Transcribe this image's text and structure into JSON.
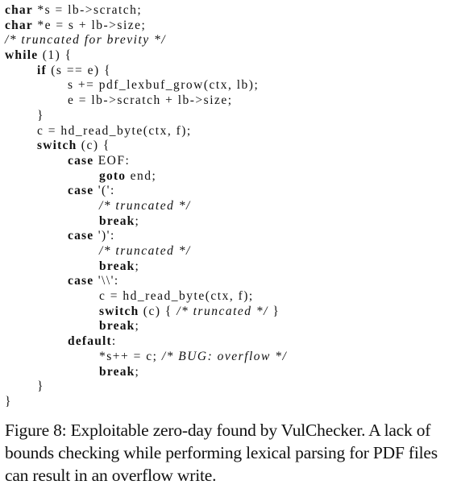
{
  "code": {
    "lines": [
      {
        "indent": 0,
        "tokens": [
          {
            "t": "char",
            "k": "kw"
          },
          {
            "t": " *s = lb->scratch;"
          }
        ]
      },
      {
        "indent": 0,
        "tokens": [
          {
            "t": "char",
            "k": "kw"
          },
          {
            "t": " *e = s + lb->size;"
          }
        ]
      },
      {
        "indent": 0,
        "tokens": [
          {
            "t": "/* truncated for brevity */",
            "k": "cm"
          }
        ]
      },
      {
        "indent": 0,
        "tokens": [
          {
            "t": "while",
            "k": "kw"
          },
          {
            "t": " (1) {"
          }
        ]
      },
      {
        "indent": 1,
        "tokens": [
          {
            "t": "if",
            "k": "kw"
          },
          {
            "t": " (s == e) {"
          }
        ]
      },
      {
        "indent": 2,
        "tokens": [
          {
            "t": "s += pdf_lexbuf_grow(ctx, lb);"
          }
        ]
      },
      {
        "indent": 2,
        "tokens": [
          {
            "t": "e = lb->scratch + lb->size;"
          }
        ]
      },
      {
        "indent": 1,
        "tokens": [
          {
            "t": "}"
          }
        ]
      },
      {
        "indent": 1,
        "tokens": [
          {
            "t": "c = hd_read_byte(ctx, f);"
          }
        ]
      },
      {
        "indent": 1,
        "tokens": [
          {
            "t": "switch",
            "k": "kw"
          },
          {
            "t": " (c) {"
          }
        ]
      },
      {
        "indent": 2,
        "tokens": [
          {
            "t": "case",
            "k": "kw"
          },
          {
            "t": " EOF:"
          }
        ]
      },
      {
        "indent": 3,
        "tokens": [
          {
            "t": "goto",
            "k": "kw"
          },
          {
            "t": " end;"
          }
        ]
      },
      {
        "indent": 2,
        "tokens": [
          {
            "t": "case",
            "k": "kw"
          },
          {
            "t": " '(':"
          }
        ]
      },
      {
        "indent": 3,
        "tokens": [
          {
            "t": "/* truncated */",
            "k": "cm"
          }
        ]
      },
      {
        "indent": 3,
        "tokens": [
          {
            "t": "break",
            "k": "kw"
          },
          {
            "t": ";"
          }
        ]
      },
      {
        "indent": 2,
        "tokens": [
          {
            "t": "case",
            "k": "kw"
          },
          {
            "t": " ')':"
          }
        ]
      },
      {
        "indent": 3,
        "tokens": [
          {
            "t": "/* truncated */",
            "k": "cm"
          }
        ]
      },
      {
        "indent": 3,
        "tokens": [
          {
            "t": "break",
            "k": "kw"
          },
          {
            "t": ";"
          }
        ]
      },
      {
        "indent": 2,
        "tokens": [
          {
            "t": "case",
            "k": "kw"
          },
          {
            "t": " '\\\\':"
          }
        ]
      },
      {
        "indent": 3,
        "tokens": [
          {
            "t": "c = hd_read_byte(ctx, f);"
          }
        ]
      },
      {
        "indent": 3,
        "tokens": [
          {
            "t": "switch",
            "k": "kw"
          },
          {
            "t": " (c) { "
          },
          {
            "t": "/* truncated */",
            "k": "cm"
          },
          {
            "t": " }"
          }
        ]
      },
      {
        "indent": 3,
        "tokens": [
          {
            "t": "break",
            "k": "kw"
          },
          {
            "t": ";"
          }
        ]
      },
      {
        "indent": 2,
        "tokens": [
          {
            "t": "default",
            "k": "kw"
          },
          {
            "t": ":"
          }
        ]
      },
      {
        "indent": 3,
        "tokens": [
          {
            "t": "*s++ = c; "
          },
          {
            "t": "/* BUG: overflow */",
            "k": "cm"
          }
        ]
      },
      {
        "indent": 3,
        "tokens": [
          {
            "t": "break",
            "k": "kw"
          },
          {
            "t": ";"
          }
        ]
      },
      {
        "indent": 1,
        "tokens": [
          {
            "t": "}"
          }
        ]
      },
      {
        "indent": 0,
        "tokens": [
          {
            "t": "}"
          }
        ]
      }
    ]
  },
  "caption": {
    "text": "Figure 8: Exploitable zero-day found by VulChecker. A lack of bounds checking while performing lexical parsing for PDF files can result in an overflow write."
  }
}
